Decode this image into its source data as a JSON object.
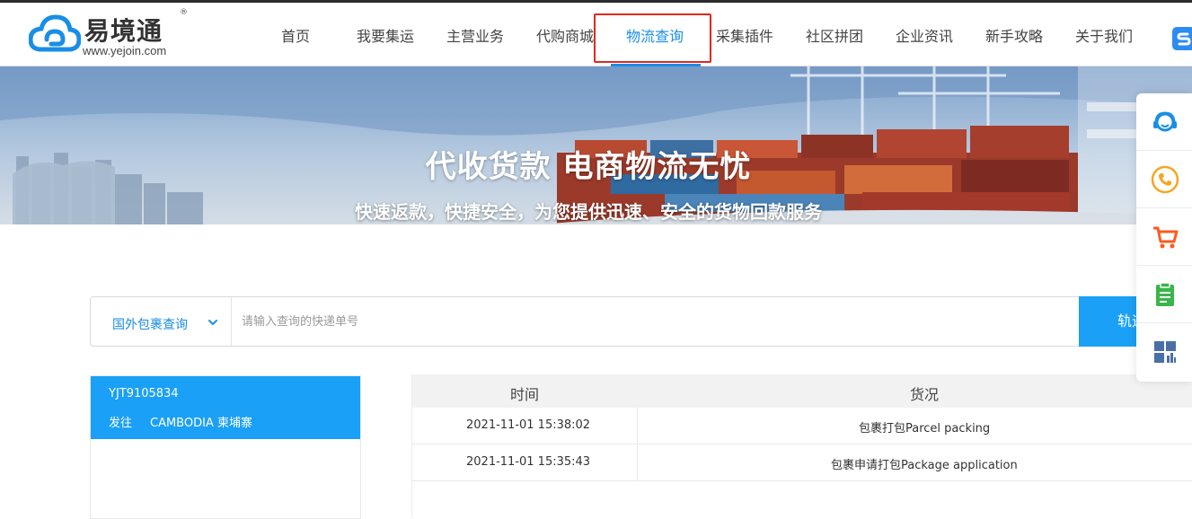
{
  "logo": {
    "name": "易境通",
    "reg": "®",
    "url": "www.yejoin.com"
  },
  "nav": {
    "items": [
      {
        "label": "首页"
      },
      {
        "label": "我要集运"
      },
      {
        "label": "主营业务"
      },
      {
        "label": "代购商城"
      },
      {
        "label": "物流查询"
      },
      {
        "label": "采集插件"
      },
      {
        "label": "社区拼团"
      },
      {
        "label": "企业资讯"
      },
      {
        "label": "新手攻略"
      },
      {
        "label": "关于我们"
      }
    ],
    "active_index": 4
  },
  "banner": {
    "title": "代收货款 电商物流无忧",
    "subtitle": "快速返款，快捷安全，为您提供迅速、安全的货物回款服务"
  },
  "search": {
    "type_label": "国外包裹查询",
    "placeholder": "请输入查询的快递单号",
    "button_label": "轨迹"
  },
  "result": {
    "tracking_number": "YJT9105834",
    "dest_label": "发往",
    "dest_value": "CAMBODIA 柬埔寨"
  },
  "table": {
    "headers": [
      "时间",
      "货况"
    ],
    "rows": [
      {
        "time": "2021-11-01 15:38:02",
        "status": "包裹打包Parcel packing"
      },
      {
        "time": "2021-11-01 15:35:43",
        "status": "包裹申请打包Package application"
      }
    ]
  },
  "sidebar": {
    "icons": [
      "customer-service-icon",
      "phone-icon",
      "cart-icon",
      "clipboard-icon",
      "dashboard-icon"
    ]
  },
  "colors": {
    "accent": "#1a8ee6",
    "button": "#1aa0f6",
    "highlight_box": "#e0281e",
    "phone": "#f5a623",
    "cart": "#ff5a1f",
    "clipboard": "#39b54a",
    "dashboard": "#4a6fa5"
  }
}
